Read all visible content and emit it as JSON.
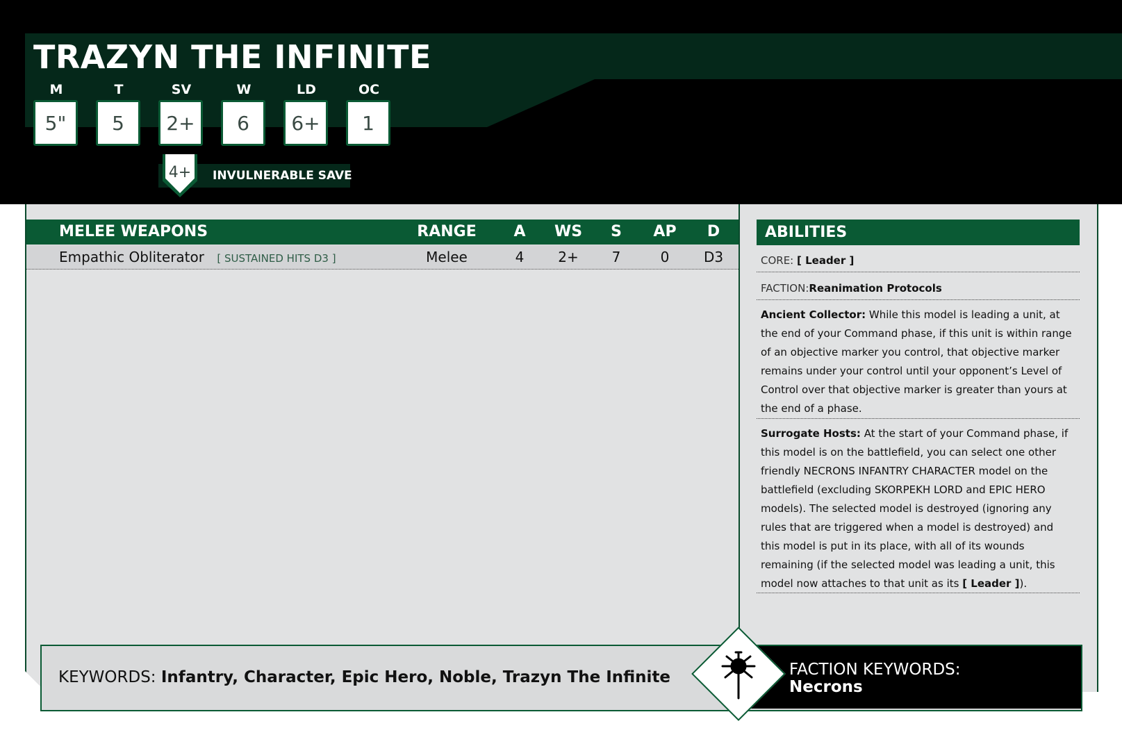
{
  "unit": {
    "name": "TRAZYN THE INFINITE",
    "stats": [
      {
        "label": "M",
        "value": "5\""
      },
      {
        "label": "T",
        "value": "5"
      },
      {
        "label": "SV",
        "value": "2+"
      },
      {
        "label": "W",
        "value": "6"
      },
      {
        "label": "LD",
        "value": "6+"
      },
      {
        "label": "OC",
        "value": "1"
      }
    ],
    "invulnerable": {
      "value": "4+",
      "label": "INVULNERABLE SAVE"
    }
  },
  "weapons": {
    "title": "MELEE WEAPONS",
    "columns": [
      "RANGE",
      "A",
      "WS",
      "S",
      "AP",
      "D"
    ],
    "rows": [
      {
        "name": "Empathic Obliterator",
        "tag": "[ SUSTAINED HITS D3 ]",
        "range": "Melee",
        "a": "4",
        "ws": "2+",
        "s": "7",
        "ap": "0",
        "d": "D3"
      }
    ]
  },
  "abilities": {
    "title": "ABILITIES",
    "core_label": "CORE:",
    "core_value": "[ Leader ]",
    "faction_label": "FACTION:",
    "faction_value": "Reanimation Protocols",
    "items": [
      {
        "name": "Ancient Collector:",
        "text": "While this model is leading a unit, at the end of your Command phase, if this unit is within range of an objective marker you control, that objective marker remains under your control until your opponent’s Level of Control over that objective marker is greater than yours at the end of a phase."
      },
      {
        "name": "Surrogate Hosts:",
        "text": "At the start of your Command phase, if this model is on the battlefield, you can select one other friendly NECRONS INFANTRY CHARACTER model on the battlefield (excluding SKORPEKH LORD and EPIC HERO models). The selected model is destroyed (ignoring any rules that are triggered when a model is destroyed) and this model is put in its place, with all of its wounds remaining (if the selected model was leading a unit, this model now attaches to that unit as its",
        "tail_bold": "[ Leader ]",
        "tail_end": ")."
      }
    ]
  },
  "keywords": {
    "label": "KEYWORDS:",
    "value": "Infantry, Character, Epic Hero, Noble, Trazyn The Infinite"
  },
  "faction_keywords": {
    "label": "FACTION KEYWORDS:",
    "value": "Necrons",
    "icon": "necron-faction-icon"
  },
  "colors": {
    "dark_green": "#05281a",
    "green": "#0a5a34",
    "panel": "#e1e2e3"
  }
}
